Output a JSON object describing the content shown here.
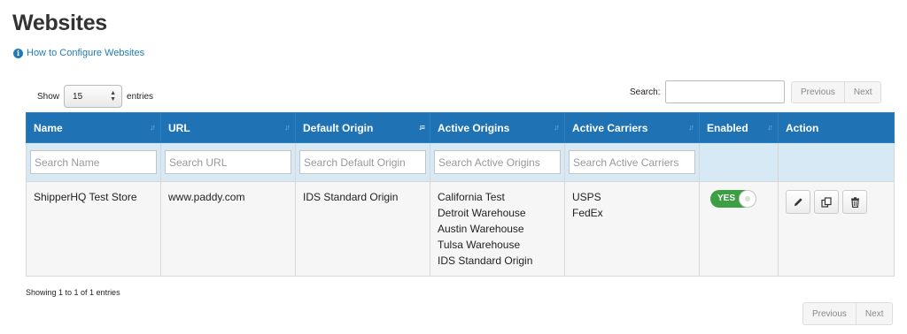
{
  "page": {
    "title": "Websites",
    "help_link": "How to Configure Websites"
  },
  "length_control": {
    "show_label": "Show",
    "selected": "15",
    "entries_label": "entries"
  },
  "search": {
    "label": "Search:"
  },
  "pagination": {
    "previous": "Previous",
    "next": "Next"
  },
  "table": {
    "columns": [
      "Name",
      "URL",
      "Default Origin",
      "Active Origins",
      "Active Carriers",
      "Enabled",
      "Action"
    ],
    "filters": [
      "Search Name",
      "Search URL",
      "Search Default Origin",
      "Search Active Origins",
      "Search Active Carriers"
    ],
    "rows": [
      {
        "name": "ShipperHQ Test Store",
        "url": "www.paddy.com",
        "default_origin": "IDS Standard Origin",
        "active_origins": [
          "California Test",
          "Detroit Warehouse",
          "Austin Warehouse",
          "Tulsa Warehouse",
          "IDS Standard Origin"
        ],
        "active_carriers": [
          "USPS",
          "FedEx"
        ],
        "enabled": "YES"
      }
    ]
  },
  "info": "Showing 1 to 1 of 1 entries",
  "colors": {
    "header": "#1f72b3",
    "filter_row": "#d8e9f6",
    "toggle_on": "#3c9f43",
    "link": "#1f7bb8"
  },
  "icons": {
    "help": "info-circle-icon",
    "edit": "pencil-icon",
    "copy": "copy-icon",
    "delete": "trash-icon",
    "sort": "sort-icon"
  }
}
